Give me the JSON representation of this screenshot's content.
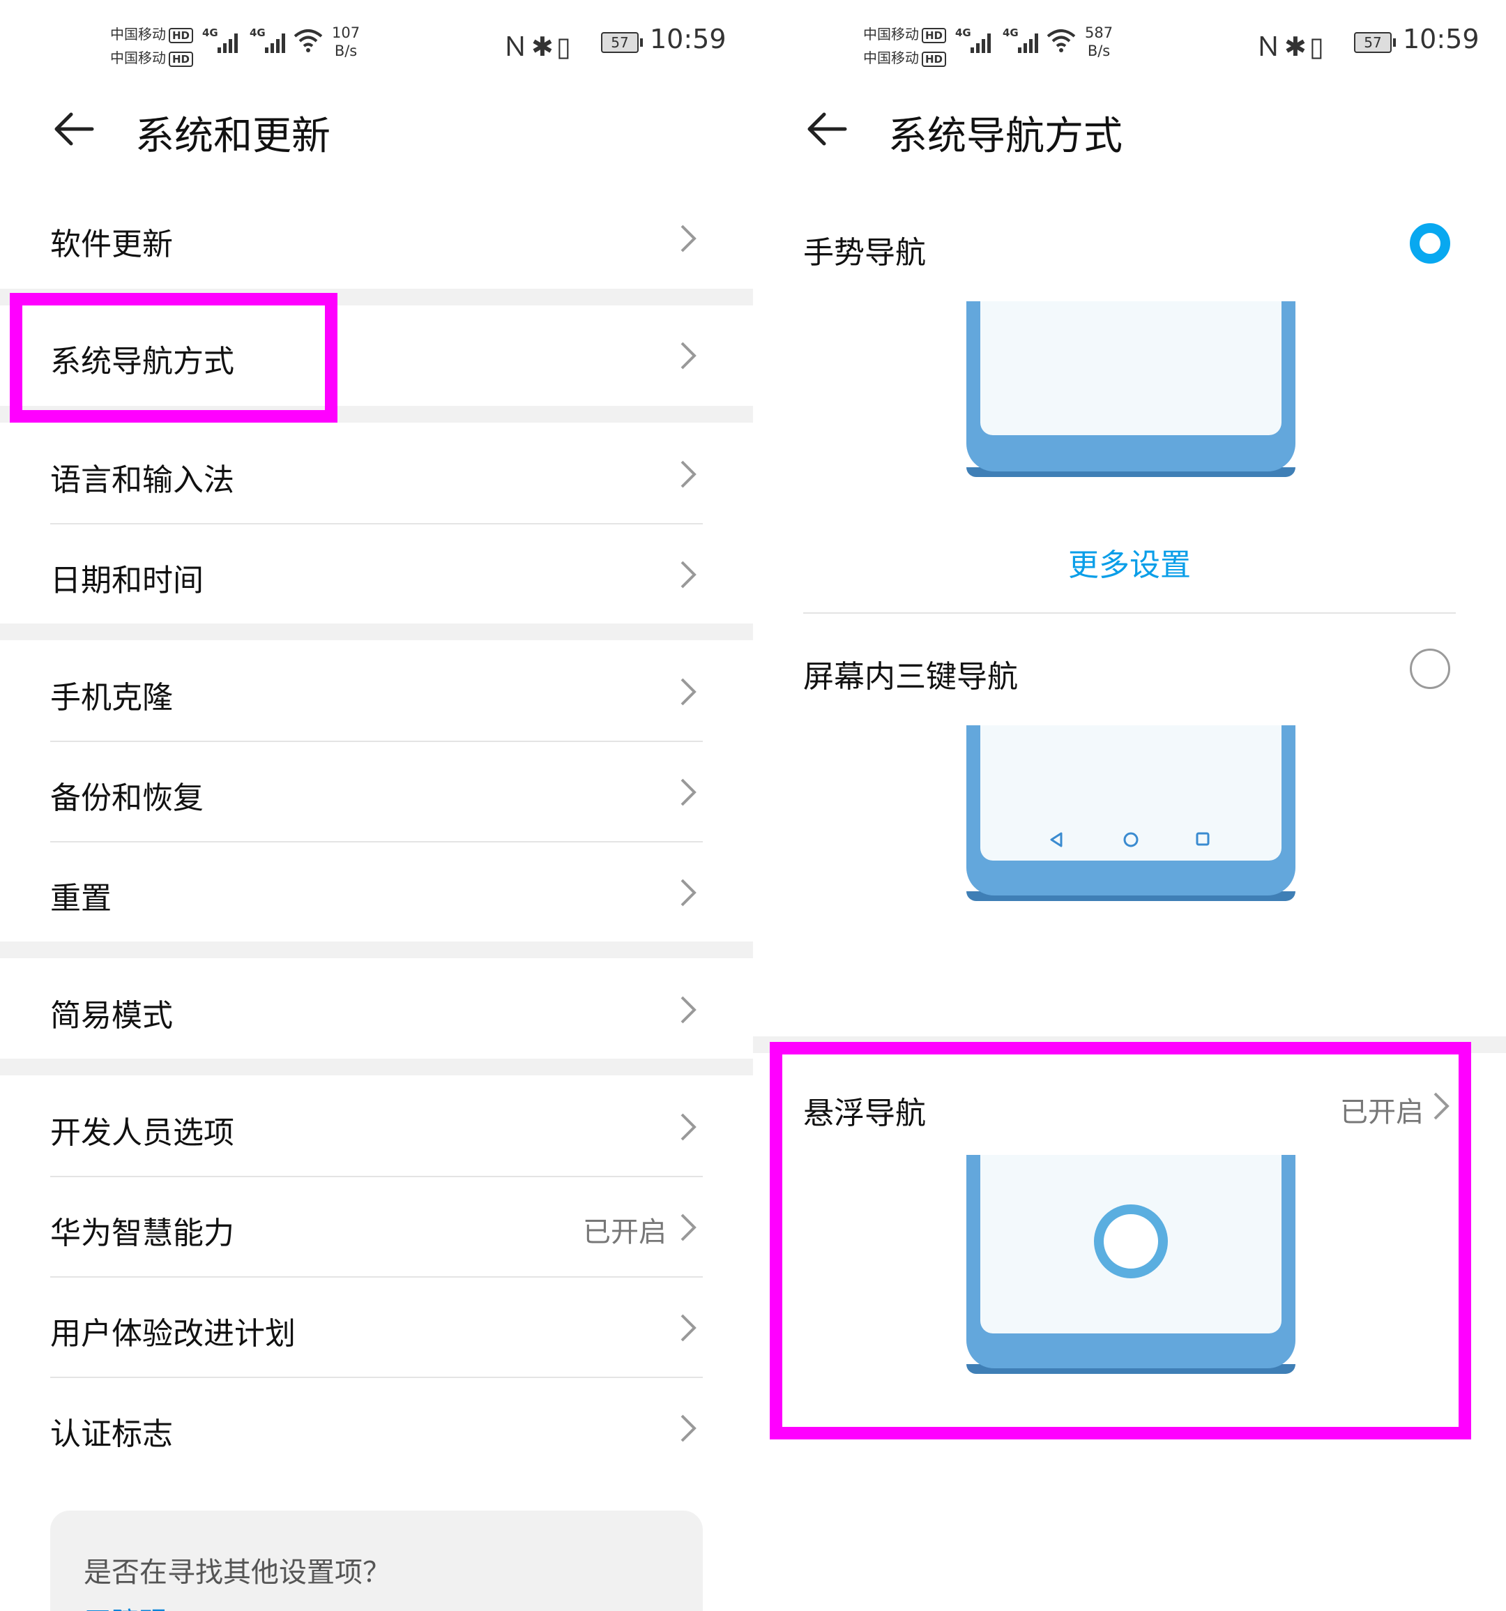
{
  "left": {
    "status": {
      "carrier1": "中国移动",
      "carrier2": "中国移动",
      "hd": "HD",
      "net": "4G",
      "speed_value": "107",
      "speed_unit": "B/s",
      "battery": "57",
      "time": "10:59"
    },
    "title": "系统和更新",
    "items": [
      {
        "label": "软件更新"
      },
      {
        "label": "系统导航方式"
      },
      {
        "label": "语言和输入法"
      },
      {
        "label": "日期和时间"
      },
      {
        "label": "手机克隆"
      },
      {
        "label": "备份和恢复"
      },
      {
        "label": "重置"
      },
      {
        "label": "简易模式"
      },
      {
        "label": "开发人员选项"
      },
      {
        "label": "华为智慧能力",
        "value": "已开启"
      },
      {
        "label": "用户体验改进计划"
      },
      {
        "label": "认证标志"
      }
    ],
    "search_card": {
      "question": "是否在寻找其他设置项？",
      "link": "无障碍"
    }
  },
  "right": {
    "status": {
      "carrier1": "中国移动",
      "carrier2": "中国移动",
      "hd": "HD",
      "net": "4G",
      "speed_value": "587",
      "speed_unit": "B/s",
      "battery": "57",
      "time": "10:59"
    },
    "title": "系统导航方式",
    "options": {
      "gesture": {
        "label": "手势导航",
        "selected": true,
        "more": "更多设置"
      },
      "three_key": {
        "label": "屏幕内三键导航",
        "selected": false
      },
      "floating": {
        "label": "悬浮导航",
        "value": "已开启"
      }
    }
  },
  "colors": {
    "highlight": "#ff00ff",
    "accent": "#08a8f0",
    "phone_blue": "#63a7dc",
    "link_blue": "#0a9ee8"
  }
}
